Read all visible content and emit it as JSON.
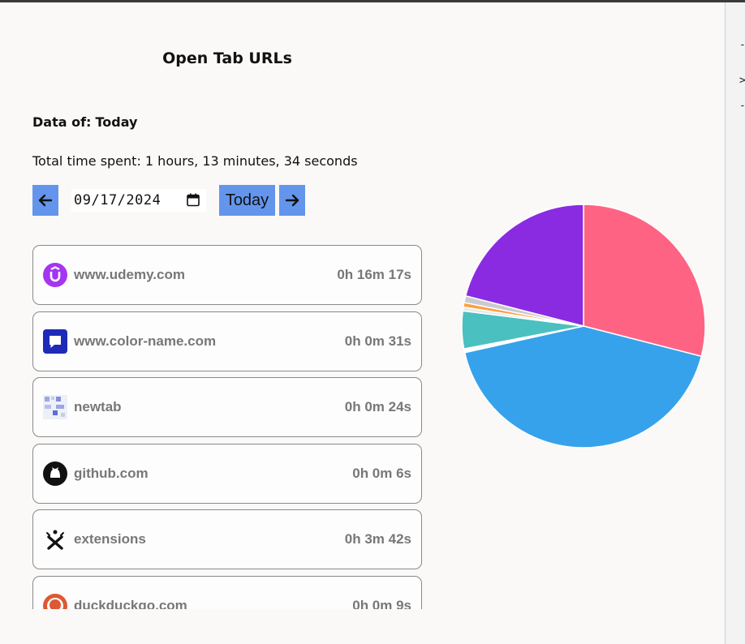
{
  "title": "Open Tab URLs",
  "data_of": {
    "label": "Data of:",
    "value": "Today"
  },
  "total_time": "Total time spent: 1 hours, 13 minutes, 34 seconds",
  "date_picker": {
    "value": "09/17/2024",
    "today_label": "Today"
  },
  "icons": {
    "prev": "arrow-left-icon",
    "next": "arrow-right-icon",
    "calendar": "calendar-icon"
  },
  "sites": [
    {
      "host": "www.udemy.com",
      "time": "0h 16m 17s",
      "icon": "udemy-icon"
    },
    {
      "host": "www.color-name.com",
      "time": "0h 0m 31s",
      "icon": "color-name-icon"
    },
    {
      "host": "newtab",
      "time": "0h 0m 24s",
      "icon": "newtab-icon"
    },
    {
      "host": "github.com",
      "time": "0h 0m 6s",
      "icon": "github-icon"
    },
    {
      "host": "extensions",
      "time": "0h 3m 42s",
      "icon": "extensions-icon"
    },
    {
      "host": "duckduckgo.com",
      "time": "0h 0m 9s",
      "icon": "duckduckgo-icon"
    }
  ],
  "chart_data": {
    "type": "pie",
    "title": "",
    "slices": [
      {
        "value": 29.0,
        "color": "#ff6384"
      },
      {
        "value": 42.5,
        "color": "#36a2eb"
      },
      {
        "value": 0.5,
        "color": "#ffffff"
      },
      {
        "value": 5.0,
        "color": "#4bc0c0"
      },
      {
        "value": 0.5,
        "color": "#e8e8e8"
      },
      {
        "value": 0.6,
        "color": "#ff9f40"
      },
      {
        "value": 0.9,
        "color": "#c9cbcf"
      },
      {
        "value": 21.0,
        "color": "#8a2be2"
      }
    ]
  }
}
